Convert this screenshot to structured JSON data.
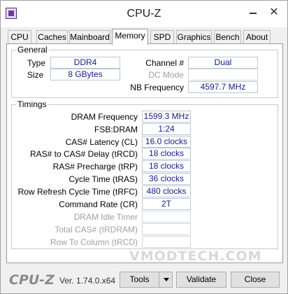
{
  "window": {
    "title": "CPU-Z",
    "close_glyph": "✕"
  },
  "tabs": [
    {
      "label": "CPU"
    },
    {
      "label": "Caches"
    },
    {
      "label": "Mainboard"
    },
    {
      "label": "Memory"
    },
    {
      "label": "SPD"
    },
    {
      "label": "Graphics"
    },
    {
      "label": "Bench"
    },
    {
      "label": "About"
    }
  ],
  "general": {
    "title": "General",
    "type_label": "Type",
    "type_value": "DDR4",
    "size_label": "Size",
    "size_value": "8 GBytes",
    "channel_label": "Channel #",
    "channel_value": "Dual",
    "dc_mode_label": "DC Mode",
    "dc_mode_value": "",
    "nb_freq_label": "NB Frequency",
    "nb_freq_value": "4597.7 MHz"
  },
  "timings": {
    "title": "Timings",
    "rows": [
      {
        "label": "DRAM Frequency",
        "value": "1599.3 MHz"
      },
      {
        "label": "FSB:DRAM",
        "value": "1:24"
      },
      {
        "label": "CAS# Latency (CL)",
        "value": "16.0 clocks"
      },
      {
        "label": "RAS# to CAS# Delay (tRCD)",
        "value": "18 clocks"
      },
      {
        "label": "RAS# Precharge (tRP)",
        "value": "18 clocks"
      },
      {
        "label": "Cycle Time (tRAS)",
        "value": "36 clocks"
      },
      {
        "label": "Row Refresh Cycle Time (tRFC)",
        "value": "480 clocks"
      },
      {
        "label": "Command Rate (CR)",
        "value": "2T"
      },
      {
        "label": "DRAM Idle Timer",
        "value": ""
      },
      {
        "label": "Total CAS# (tRDRAM)",
        "value": ""
      },
      {
        "label": "Row To Column (tRCD)",
        "value": ""
      }
    ]
  },
  "watermark": "VMODTECH.COM",
  "footer": {
    "brand": "CPU-Z",
    "version": "Ver. 1.74.0.x64",
    "tools_label": "Tools",
    "validate_label": "Validate",
    "close_label": "Close"
  }
}
